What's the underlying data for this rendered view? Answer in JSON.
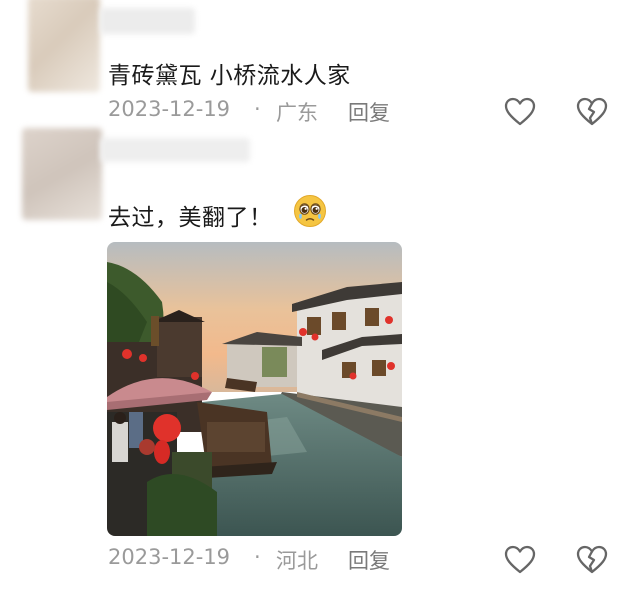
{
  "comments": [
    {
      "text": "青砖黛瓦 小桥流水人家",
      "date": "2023-12-19",
      "separator": "·",
      "location": "广东",
      "reply_label": "回复",
      "icons": {
        "like": "heart-outline-icon",
        "dislike": "broken-heart-icon"
      }
    },
    {
      "text": "去过，美翻了！",
      "emoji": "teary-eyed-face-emoji",
      "attachment": "photo-canal-town-at-sunset",
      "date": "2023-12-19",
      "separator": "·",
      "location": "河北",
      "reply_label": "回复",
      "icons": {
        "like": "heart-outline-icon",
        "dislike": "broken-heart-icon"
      }
    }
  ],
  "colors": {
    "text": "#1a1a1a",
    "meta": "#9a9a9a",
    "icon": "#666666",
    "emoji": "#f5c542"
  }
}
